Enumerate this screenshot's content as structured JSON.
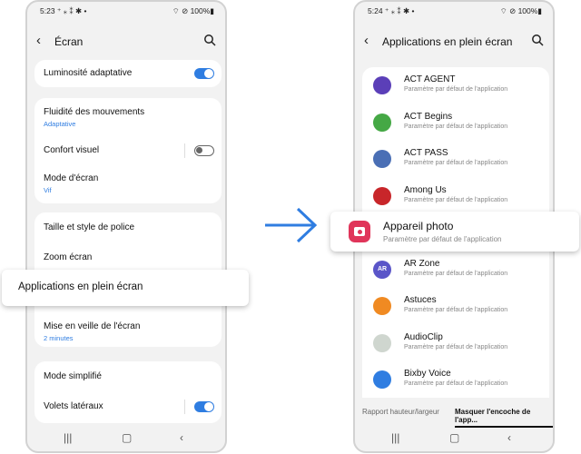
{
  "left": {
    "status": {
      "time": "5:23 ⁺ ⁎ ⁑ ✱ •",
      "right": "⌔ ⊘ 100%▮"
    },
    "title": "Écran",
    "rows": {
      "luminosite": "Luminosité adaptative",
      "fluidite": "Fluidité des mouvements",
      "fluidite_sub": "Adaptative",
      "confort": "Confort visuel",
      "mode": "Mode d'écran",
      "mode_sub": "Vif",
      "taille": "Taille et style de police",
      "zoom": "Zoom écran",
      "applications": "Applications en plein écran",
      "veille": "Mise en veille de l'écran",
      "veille_sub": "2 minutes",
      "simplifie": "Mode simplifié",
      "volets": "Volets latéraux"
    },
    "toggles": {
      "luminosite": true,
      "confort": false,
      "volets": true
    }
  },
  "right": {
    "status": {
      "time": "5:24 ⁺ ⁎ ⁑ ✱ •",
      "right": "⌔ ⊘ 100%▮"
    },
    "title": "Applications en plein écran",
    "apps": [
      {
        "name": "ACT AGENT",
        "desc": "Paramètre par défaut de l'application",
        "icon": "act-agent-icon",
        "color": "#5b3fb8"
      },
      {
        "name": "ACT Begins",
        "desc": "Paramètre par défaut de l'application",
        "icon": "act-begins-icon",
        "color": "#45a845"
      },
      {
        "name": "ACT PASS",
        "desc": "Paramètre par défaut de l'application",
        "icon": "act-pass-icon",
        "color": "#4a6fb5"
      },
      {
        "name": "Among Us",
        "desc": "Paramètre par défaut de l'application",
        "icon": "among-us-icon",
        "color": "#c8262a"
      },
      {
        "name": "Appareil photo",
        "desc": "Paramètre par défaut de l'application",
        "icon": "camera-icon",
        "color": "#e0355a"
      },
      {
        "name": "AR Zone",
        "desc": "Paramètre par défaut de l'application",
        "icon": "ar-zone-icon",
        "color": "#5a55c8",
        "label": "AR"
      },
      {
        "name": "Astuces",
        "desc": "Paramètre par défaut de l'application",
        "icon": "tips-icon",
        "color": "#f08a22"
      },
      {
        "name": "AudioClip",
        "desc": "Paramètre par défaut de l'application",
        "icon": "audioclip-icon",
        "color": "#cfd6cf"
      },
      {
        "name": "Bixby Voice",
        "desc": "Paramètre par défaut de l'application",
        "icon": "bixby-icon",
        "color": "#2f7de1"
      }
    ],
    "tabs": {
      "ratio": "Rapport hauteur/largeur",
      "notch": "Masquer l'encoche de l'app..."
    }
  },
  "colors": {
    "accent": "#2f7de1",
    "arrow": "#2f7de1"
  }
}
